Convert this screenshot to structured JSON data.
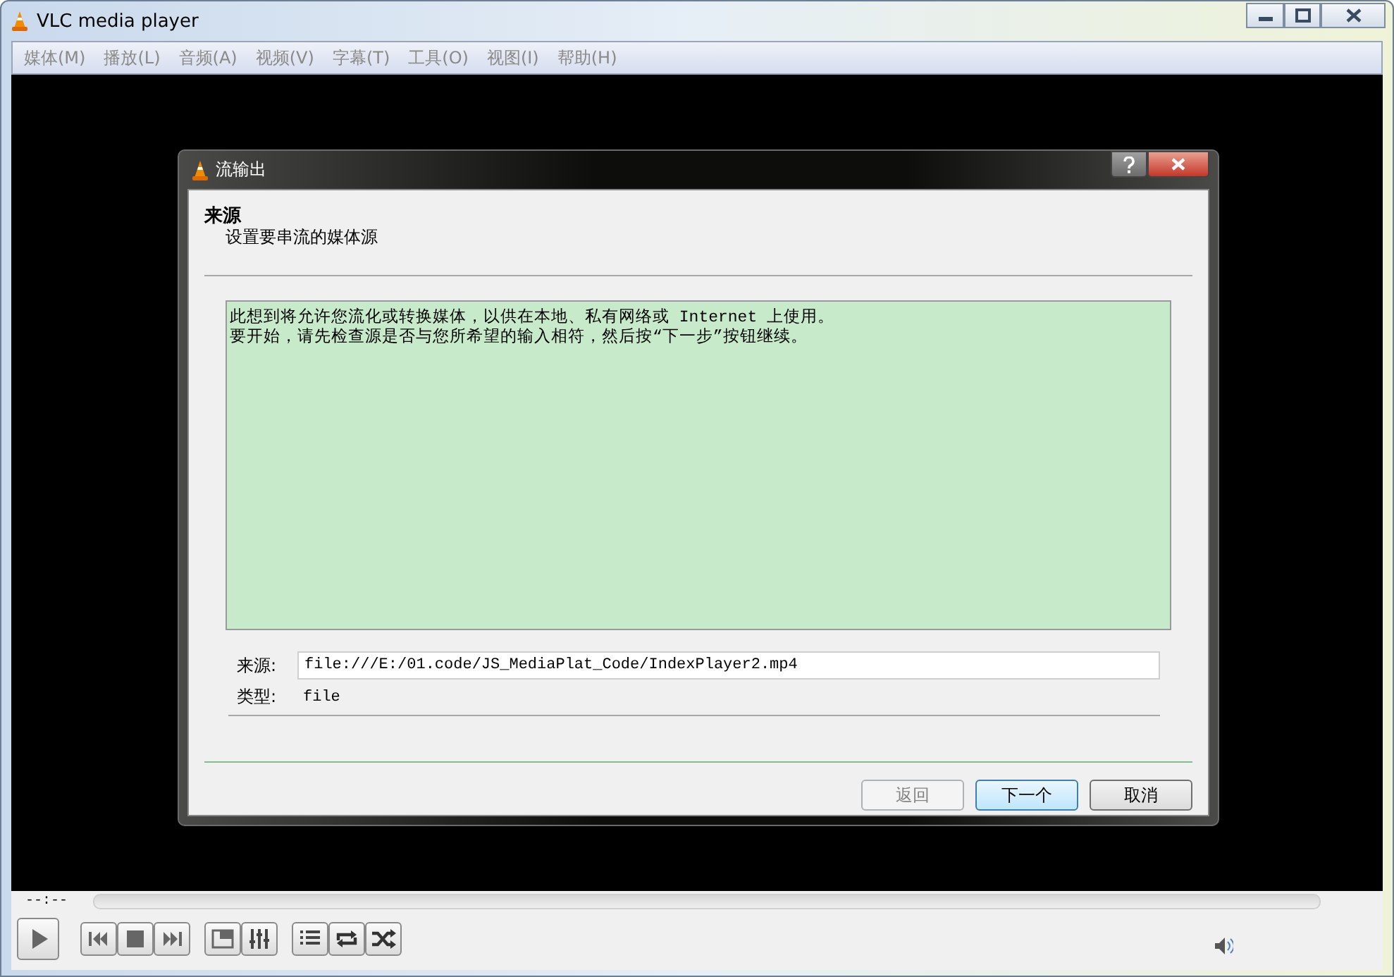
{
  "window": {
    "title": "VLC media player"
  },
  "menu": [
    {
      "label": "媒体(M)",
      "disabled": true
    },
    {
      "label": "播放(L)",
      "disabled": true
    },
    {
      "label": "音频(A)",
      "disabled": true
    },
    {
      "label": "视频(V)",
      "disabled": true
    },
    {
      "label": "字幕(T)",
      "disabled": true
    },
    {
      "label": "工具(O)",
      "disabled": true
    },
    {
      "label": "视图(I)",
      "disabled": true
    },
    {
      "label": "帮助(H)",
      "disabled": true
    }
  ],
  "dialog": {
    "title": "流输出",
    "heading": "来源",
    "subheading": "设置要串流的媒体源",
    "info": [
      "此想到将允许您流化或转换媒体，以供在本地、私有网络或 Internet 上使用。",
      "要开始，请先检查源是否与您所希望的输入相符，然后按“下一步”按钮继续。"
    ],
    "source_label": "来源:",
    "source_value": "file:///E:/01.code/JS_MediaPlat_Code/IndexPlayer2.mp4",
    "type_label": "类型:",
    "type_value": "file",
    "buttons": [
      {
        "label": "返回",
        "disabled": true,
        "default": false
      },
      {
        "label": "下一个",
        "disabled": false,
        "default": true
      },
      {
        "label": "取消",
        "disabled": false,
        "default": false
      }
    ]
  },
  "player": {
    "elapsed": "--:--",
    "controls": [
      {
        "kind": "play"
      },
      {
        "kind": "prev"
      },
      {
        "kind": "stop"
      },
      {
        "kind": "next"
      },
      {
        "kind": "fullscreen"
      },
      {
        "kind": "extended"
      },
      {
        "kind": "playlist"
      },
      {
        "kind": "loop"
      },
      {
        "kind": "shuffle"
      }
    ]
  }
}
